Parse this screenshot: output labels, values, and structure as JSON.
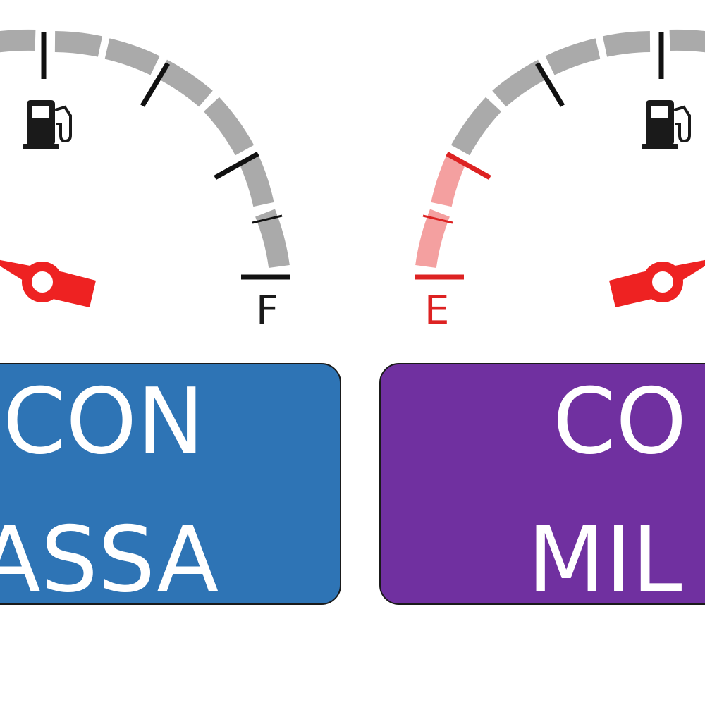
{
  "gauges": [
    {
      "id": "left",
      "label_letter": "F",
      "letter_color": "#1a1a1a",
      "icon": "fuel-pump-icon",
      "needle_color": "#ee2222",
      "band_color": "#aaaaaa",
      "tick_color": "#111111"
    },
    {
      "id": "right",
      "label_letter": "E",
      "letter_color": "#dd2222",
      "icon": "fuel-pump-icon",
      "needle_color": "#ee2222",
      "band_color": "#aaaaaa",
      "low_band_color": "#f4a0a0",
      "tick_color": "#111111",
      "low_tick_color": "#dd2222"
    }
  ],
  "labels": [
    {
      "id": "left",
      "line1": "CON",
      "line2": "ASSA",
      "color": "#2e74b5"
    },
    {
      "id": "right",
      "line1": "CO",
      "line2": "MIL",
      "color": "#7030a0"
    }
  ]
}
